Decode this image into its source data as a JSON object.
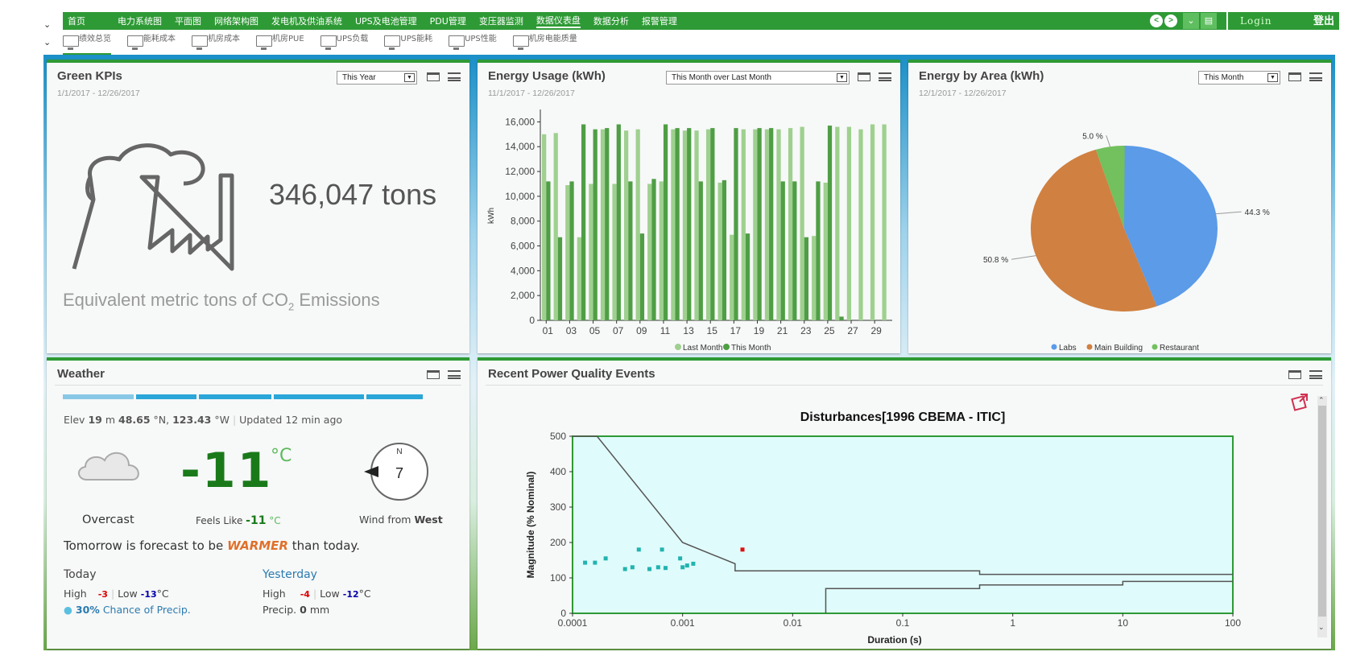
{
  "nav": {
    "items": [
      "首页",
      "电力系统图",
      "平面图",
      "网络架构图",
      "发电机及供油系统",
      "UPS及电池管理",
      "PDU管理",
      "变压器监测",
      "数据仪表盘",
      "数据分析",
      "报警管理"
    ],
    "active_index": 8,
    "login": "Login",
    "logout": "登出"
  },
  "subnav": {
    "items": [
      "绩效总览",
      "能耗成本",
      "机房成本",
      "机房PUE",
      "UPS负载",
      "UPS能耗",
      "UPS性能",
      "机房电能质量"
    ],
    "active_index": 0
  },
  "green_kpis": {
    "title": "Green KPIs",
    "date_range": "1/1/2017 - 12/26/2017",
    "select": "This Year",
    "value": "346,047 tons",
    "caption_main": "Equivalent metric tons of CO",
    "caption_sub": "2",
    "caption_end": " Emissions"
  },
  "energy_usage": {
    "title": "Energy Usage (kWh)",
    "date_range": "11/1/2017 - 12/26/2017",
    "select": "This Month over Last Month"
  },
  "energy_area": {
    "title": "Energy by Area (kWh)",
    "date_range": "12/1/2017 - 12/26/2017",
    "select": "This Month"
  },
  "weather": {
    "title": "Weather",
    "elev": "19",
    "lat": "48.65",
    "lon": "123.43",
    "updated": "12 min ago",
    "condition": "Overcast",
    "temp": "-11",
    "unit": "°C",
    "feels_label": "Feels Like",
    "feels": "-11",
    "compass_n": "N",
    "wind_speed": "7",
    "wind_label": "Wind from",
    "wind_dir": "West",
    "forecast_pre": "Tomorrow is forecast to be",
    "forecast_word": "WARMER",
    "forecast_post": "than today.",
    "today": {
      "label": "Today",
      "high": "-3",
      "low": "-13",
      "precip_pct": "30%",
      "precip_text": "Chance of Precip."
    },
    "yesterday": {
      "label": "Yesterday",
      "high": "-4",
      "low": "-12",
      "precip": "0",
      "precip_unit": "mm"
    },
    "txt": {
      "elev": "Elev",
      "m": "m",
      "n": "°N,",
      "w": "°W",
      "upd": "Updated",
      "high": "High",
      "low": "Low",
      "c": "°C",
      "precip": "Precip."
    }
  },
  "power_quality": {
    "title": "Recent Power Quality Events"
  },
  "colors": {
    "green": "#2e9a35",
    "light_green_bar": "#9fd08f",
    "dark_green_bar": "#4f9e45",
    "labs": "#5b9be8",
    "main_building": "#d08040",
    "restaurant": "#72c05e",
    "event_normal": "#22b3b0",
    "event_alert": "#e01010"
  },
  "chart_data": [
    {
      "type": "bar",
      "ylabel": "kWh",
      "ylim": [
        0,
        17000
      ],
      "yticks": [
        0,
        2000,
        4000,
        6000,
        8000,
        10000,
        12000,
        14000,
        16000
      ],
      "ytick_labels": [
        "0",
        "2,000",
        "4,000",
        "6,000",
        "8,000",
        "10,000",
        "12,000",
        "14,000",
        "16,000"
      ],
      "xtick_labels": [
        "01",
        "03",
        "05",
        "07",
        "09",
        "11",
        "13",
        "15",
        "17",
        "19",
        "21",
        "23",
        "25",
        "27",
        "29"
      ],
      "categories": [
        "01",
        "02",
        "03",
        "04",
        "05",
        "06",
        "07",
        "08",
        "09",
        "10",
        "11",
        "12",
        "13",
        "14",
        "15",
        "16",
        "17",
        "18",
        "19",
        "20",
        "21",
        "22",
        "23",
        "24",
        "25",
        "26",
        "27",
        "28",
        "29",
        "30"
      ],
      "series": [
        {
          "name": "Last Month",
          "values": [
            15000,
            15100,
            10900,
            6700,
            11000,
            15400,
            11000,
            15300,
            15400,
            11000,
            11200,
            15400,
            15300,
            15300,
            15400,
            11100,
            6900,
            15400,
            15400,
            15400,
            15400,
            15500,
            15600,
            6800,
            11100,
            15600,
            15600,
            15400,
            15800,
            15800
          ]
        },
        {
          "name": "This Month",
          "values": [
            11200,
            6700,
            11200,
            15800,
            15400,
            15500,
            15800,
            11200,
            7000,
            11400,
            15800,
            15500,
            15500,
            11200,
            15500,
            11300,
            15500,
            7000,
            15500,
            15500,
            11200,
            11200,
            6700,
            11200,
            15700,
            300,
            null,
            null,
            null,
            null
          ]
        }
      ]
    },
    {
      "type": "pie",
      "series": [
        {
          "name": "Labs",
          "values": [
            44.3
          ]
        },
        {
          "name": "Main Building",
          "values": [
            50.8
          ]
        },
        {
          "name": "Restaurant",
          "values": [
            5.0
          ]
        }
      ],
      "labels": [
        "44.3 %",
        "50.8 %",
        "5.0 %"
      ]
    },
    {
      "type": "scatter",
      "title": "Disturbances[1996 CBEMA - ITIC]",
      "xlabel": "Duration (s)",
      "ylabel": "Magnitude (% Nominal)",
      "xscale": "log",
      "xlim": [
        0.0001,
        100
      ],
      "ylim": [
        0,
        500
      ],
      "xtick_labels": [
        "0.0001",
        "0.001",
        "0.01",
        "0.1",
        "1",
        "10",
        "100"
      ],
      "yticks": [
        0,
        100,
        200,
        300,
        400,
        500
      ],
      "upper_curve": [
        [
          0.0001,
          500
        ],
        [
          0.000167,
          500
        ],
        [
          0.001,
          200
        ],
        [
          0.003,
          140
        ],
        [
          0.003,
          120
        ],
        [
          0.5,
          120
        ],
        [
          0.5,
          110
        ],
        [
          100,
          110
        ]
      ],
      "lower_curve": [
        [
          0.02,
          0
        ],
        [
          0.02,
          70
        ],
        [
          0.5,
          70
        ],
        [
          0.5,
          80
        ],
        [
          10,
          80
        ],
        [
          10,
          90
        ],
        [
          100,
          90
        ]
      ],
      "points": [
        {
          "x": 0.00013,
          "y": 143
        },
        {
          "x": 0.00016,
          "y": 143
        },
        {
          "x": 0.0002,
          "y": 155
        },
        {
          "x": 0.0003,
          "y": 125
        },
        {
          "x": 0.00035,
          "y": 130
        },
        {
          "x": 0.0004,
          "y": 180
        },
        {
          "x": 0.0005,
          "y": 125
        },
        {
          "x": 0.0006,
          "y": 130
        },
        {
          "x": 0.00065,
          "y": 180
        },
        {
          "x": 0.0007,
          "y": 128
        },
        {
          "x": 0.00095,
          "y": 155
        },
        {
          "x": 0.001,
          "y": 130
        },
        {
          "x": 0.0011,
          "y": 135
        },
        {
          "x": 0.00125,
          "y": 140
        },
        {
          "x": 0.0035,
          "y": 180,
          "alert": true
        }
      ]
    }
  ]
}
